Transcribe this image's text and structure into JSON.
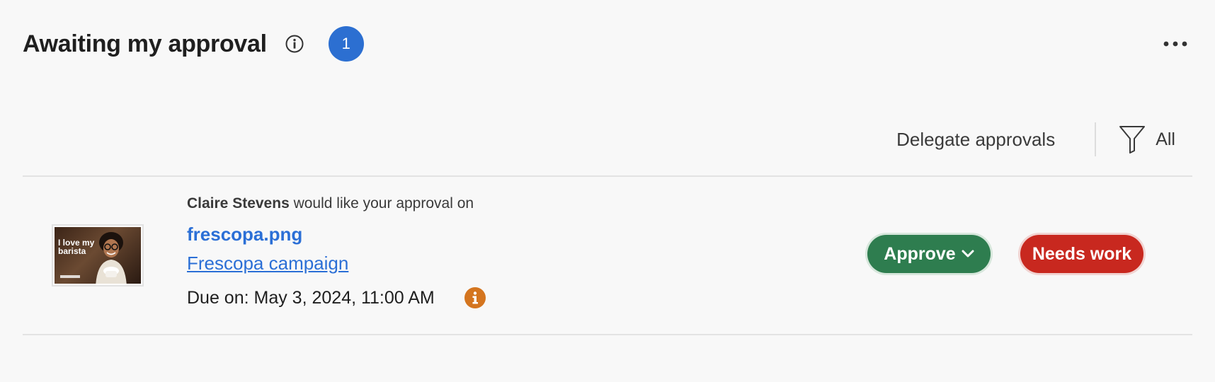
{
  "header": {
    "title": "Awaiting my approval",
    "info_icon": "info-circle-icon",
    "count": "1",
    "more_icon": "more-horizontal-icon"
  },
  "toolbar": {
    "delegate_label": "Delegate approvals",
    "filter_icon": "funnel-icon",
    "filter_label": "All"
  },
  "approvals": [
    {
      "thumbnail_text": "I love my barista",
      "requester": "Claire Stevens",
      "request_text": " would like your approval on",
      "file_name": "frescopa.png",
      "campaign": "Frescopa campaign",
      "due": "Due on: May 3, 2024, 11:00 AM",
      "due_icon": "info-icon",
      "approve_label": "Approve",
      "needs_work_label": "Needs work"
    }
  ],
  "colors": {
    "badge": "#2c6fd1",
    "link": "#2b6fd6",
    "approve": "#2e7d4f",
    "needs_work": "#c8281f",
    "due_info": "#d4751f"
  }
}
